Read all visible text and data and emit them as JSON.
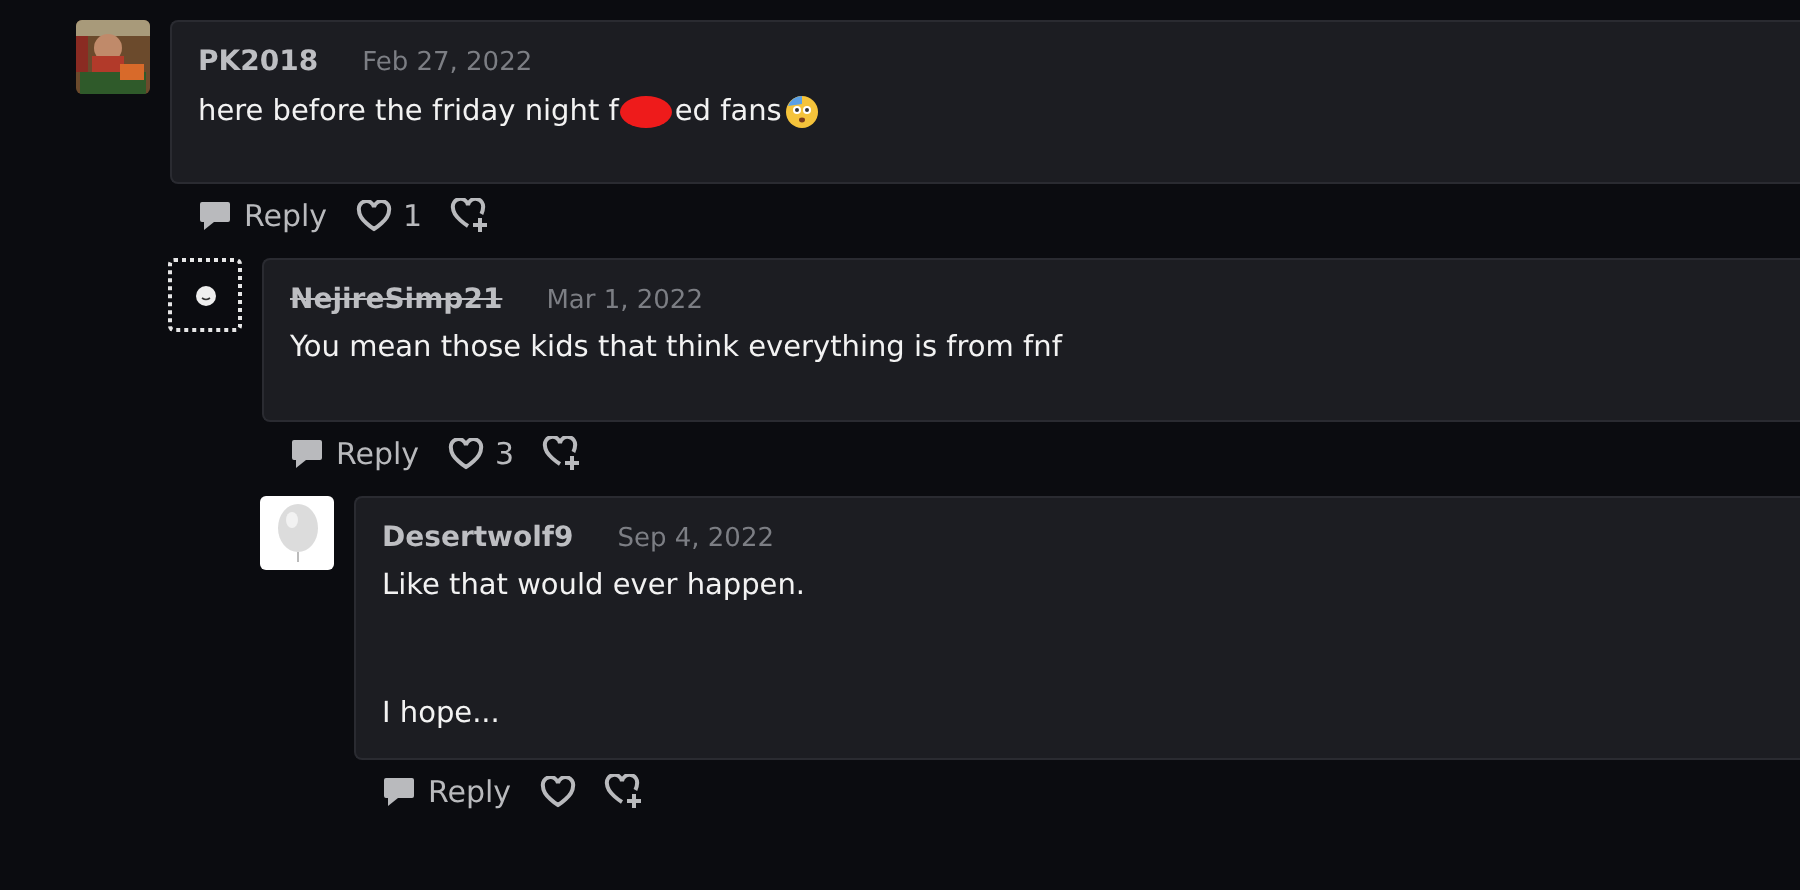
{
  "comments": [
    {
      "author": "PK2018",
      "author_struck": false,
      "date": "Feb 27, 2022",
      "body": [
        {
          "kind": "text",
          "text": "here before the friday night f"
        },
        {
          "kind": "redaction"
        },
        {
          "kind": "text",
          "text": "ed fans"
        },
        {
          "kind": "emoji"
        }
      ],
      "actions": {
        "reply": "Reply",
        "likes": "1"
      },
      "children": [
        {
          "author": "NejireSimp21",
          "author_struck": true,
          "date": "Mar 1, 2022",
          "avatar": {
            "kind": "placeholder"
          },
          "body": [
            {
              "kind": "text",
              "text": "You mean those kids that think everything is from fnf"
            }
          ],
          "actions": {
            "reply": "Reply",
            "likes": "3"
          },
          "children": [
            {
              "author": "Desertwolf9",
              "author_struck": false,
              "date": "Sep 4, 2022",
              "avatar": {
                "kind": "balloon"
              },
              "body": [
                {
                  "kind": "text",
                  "text": "Like that would ever happen."
                },
                {
                  "kind": "break"
                },
                {
                  "kind": "text",
                  "text": "I hope..."
                }
              ],
              "actions": {
                "reply": "Reply"
              }
            }
          ]
        }
      ]
    }
  ]
}
